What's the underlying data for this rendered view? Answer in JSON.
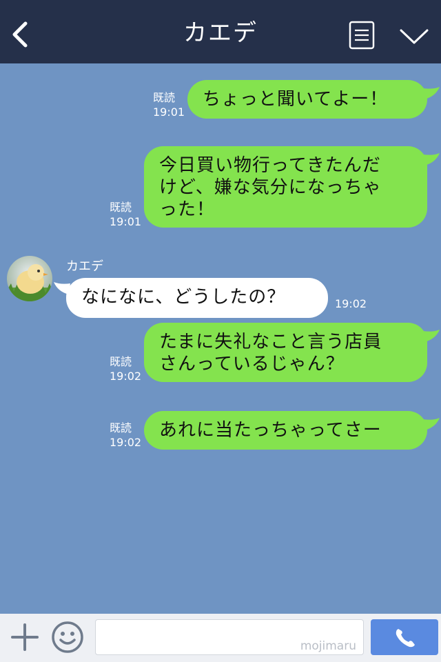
{
  "header": {
    "title": "カエデ",
    "back_icon": "chevron-left-icon",
    "menu_icon": "document-list-icon",
    "collapse_icon": "chevron-down-icon"
  },
  "messages": [
    {
      "text": "ちょっと聞いてよー！",
      "read_label": "既読",
      "time": "19:01"
    },
    {
      "lines": [
        "今日買い物行ってきたんだ",
        "けど、嫌な気分になっちゃ",
        "った！"
      ],
      "read_label": "既読",
      "time": "19:01"
    },
    {
      "sender": "カエデ",
      "text": "なになに、どうしたの？",
      "time": "19:02"
    },
    {
      "lines": [
        "たまに失礼なこと言う店員",
        "さんっているじゃん？"
      ],
      "read_label": "既読",
      "time": "19:02"
    },
    {
      "text": "あれに当たっちゃってさー",
      "read_label": "既読",
      "time": "19:02"
    }
  ],
  "footer": {
    "input_watermark": "mojimaru",
    "plus_icon": "plus-icon",
    "emoji_icon": "smiley-icon",
    "call_icon": "phone-icon"
  },
  "colors": {
    "header_bg": "#25304a",
    "chat_bg": "#6f94c3",
    "sent_bubble": "#84e34e",
    "received_bubble": "#ffffff",
    "send_button": "#5a8ae0"
  }
}
